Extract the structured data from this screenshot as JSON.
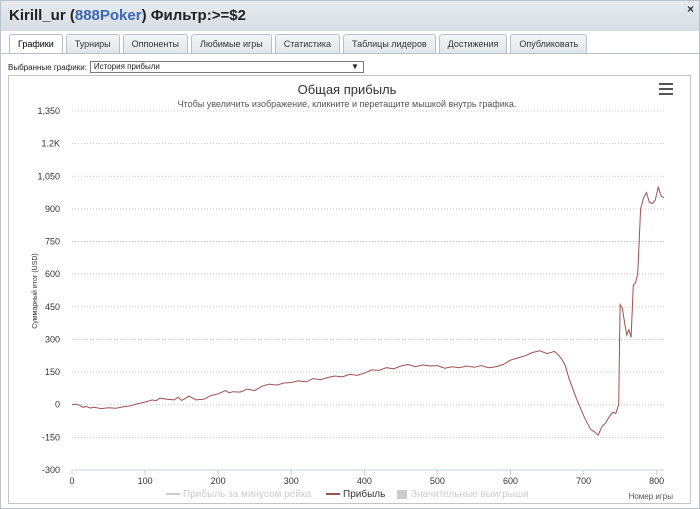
{
  "window": {
    "title_user": "Kirill_ur",
    "title_open": " (",
    "title_site": "888Poker",
    "title_close": ")",
    "title_filter": " Фильтр:>=$2",
    "close_icon": "×"
  },
  "tabs": [
    {
      "label": "Графики",
      "active": true
    },
    {
      "label": "Турниры"
    },
    {
      "label": "Оппоненты"
    },
    {
      "label": "Любимые игры"
    },
    {
      "label": "Статистика"
    },
    {
      "label": "Таблицы лидеров"
    },
    {
      "label": "Достижения"
    },
    {
      "label": "Опубликовать"
    }
  ],
  "selector": {
    "label": "Выбранные графики:",
    "value": "История прибыли",
    "arrow": "▼"
  },
  "chart_data": {
    "type": "line",
    "title": "Общая прибыль",
    "subtitle": "Чтобы увеличить изображение, кликните и перетащите мышкой внутрь графика.",
    "ylabel": "Суммарный итог (USD)",
    "xlabel": "Номер игры",
    "xlim": [
      0,
      810
    ],
    "ylim": [
      -300,
      1350
    ],
    "x_ticks": [
      0,
      100,
      200,
      300,
      400,
      500,
      600,
      700,
      800
    ],
    "y_ticks": [
      -300,
      -150,
      0,
      150,
      300,
      450,
      600,
      750,
      900,
      1050,
      1200,
      1350
    ],
    "y_tick_labels": [
      "-300",
      "-150",
      "0",
      "150",
      "300",
      "450",
      "600",
      "750",
      "900",
      "1,050",
      "1.2K",
      "1,350"
    ],
    "grid": true,
    "legend_position": "bottom",
    "series": [
      {
        "name": "Прибыль за минусом рейка",
        "color": "#cccccc",
        "visible": false,
        "points": []
      },
      {
        "name": "Прибыль",
        "color": "#a0504f",
        "visible": true,
        "points": [
          [
            0,
            0
          ],
          [
            5,
            3
          ],
          [
            10,
            -2
          ],
          [
            15,
            -12
          ],
          [
            20,
            -8
          ],
          [
            25,
            -15
          ],
          [
            30,
            -12
          ],
          [
            40,
            -18
          ],
          [
            50,
            -14
          ],
          [
            60,
            -16
          ],
          [
            70,
            -10
          ],
          [
            80,
            -5
          ],
          [
            90,
            5
          ],
          [
            100,
            12
          ],
          [
            110,
            22
          ],
          [
            115,
            18
          ],
          [
            120,
            30
          ],
          [
            130,
            25
          ],
          [
            140,
            22
          ],
          [
            145,
            35
          ],
          [
            150,
            20
          ],
          [
            155,
            28
          ],
          [
            160,
            40
          ],
          [
            165,
            30
          ],
          [
            170,
            22
          ],
          [
            180,
            25
          ],
          [
            190,
            42
          ],
          [
            200,
            50
          ],
          [
            210,
            65
          ],
          [
            215,
            55
          ],
          [
            220,
            60
          ],
          [
            230,
            58
          ],
          [
            240,
            72
          ],
          [
            250,
            65
          ],
          [
            260,
            85
          ],
          [
            270,
            95
          ],
          [
            280,
            90
          ],
          [
            290,
            100
          ],
          [
            300,
            102
          ],
          [
            310,
            110
          ],
          [
            320,
            105
          ],
          [
            330,
            120
          ],
          [
            340,
            115
          ],
          [
            350,
            125
          ],
          [
            360,
            132
          ],
          [
            370,
            128
          ],
          [
            380,
            140
          ],
          [
            390,
            135
          ],
          [
            400,
            145
          ],
          [
            410,
            160
          ],
          [
            420,
            158
          ],
          [
            430,
            170
          ],
          [
            440,
            165
          ],
          [
            450,
            178
          ],
          [
            460,
            185
          ],
          [
            470,
            175
          ],
          [
            480,
            183
          ],
          [
            490,
            178
          ],
          [
            500,
            180
          ],
          [
            510,
            168
          ],
          [
            520,
            175
          ],
          [
            530,
            170
          ],
          [
            540,
            178
          ],
          [
            550,
            172
          ],
          [
            560,
            180
          ],
          [
            570,
            170
          ],
          [
            580,
            175
          ],
          [
            590,
            185
          ],
          [
            600,
            205
          ],
          [
            610,
            215
          ],
          [
            620,
            225
          ],
          [
            630,
            240
          ],
          [
            640,
            248
          ],
          [
            650,
            235
          ],
          [
            660,
            245
          ],
          [
            665,
            230
          ],
          [
            670,
            210
          ],
          [
            675,
            180
          ],
          [
            680,
            120
          ],
          [
            690,
            30
          ],
          [
            700,
            -50
          ],
          [
            705,
            -85
          ],
          [
            710,
            -115
          ],
          [
            715,
            -125
          ],
          [
            720,
            -140
          ],
          [
            725,
            -100
          ],
          [
            730,
            -85
          ],
          [
            735,
            -55
          ],
          [
            740,
            -35
          ],
          [
            744,
            -40
          ],
          [
            748,
            0
          ],
          [
            750,
            460
          ],
          [
            753,
            445
          ],
          [
            756,
            380
          ],
          [
            759,
            320
          ],
          [
            762,
            345
          ],
          [
            765,
            310
          ],
          [
            768,
            550
          ],
          [
            771,
            560
          ],
          [
            774,
            600
          ],
          [
            778,
            900
          ],
          [
            782,
            950
          ],
          [
            786,
            975
          ],
          [
            790,
            930
          ],
          [
            794,
            925
          ],
          [
            798,
            940
          ],
          [
            802,
            1000
          ],
          [
            806,
            960
          ],
          [
            810,
            950
          ]
        ]
      },
      {
        "name": "Значительные выигрыши",
        "color": "#cccccc",
        "visible": false,
        "points": []
      }
    ]
  }
}
